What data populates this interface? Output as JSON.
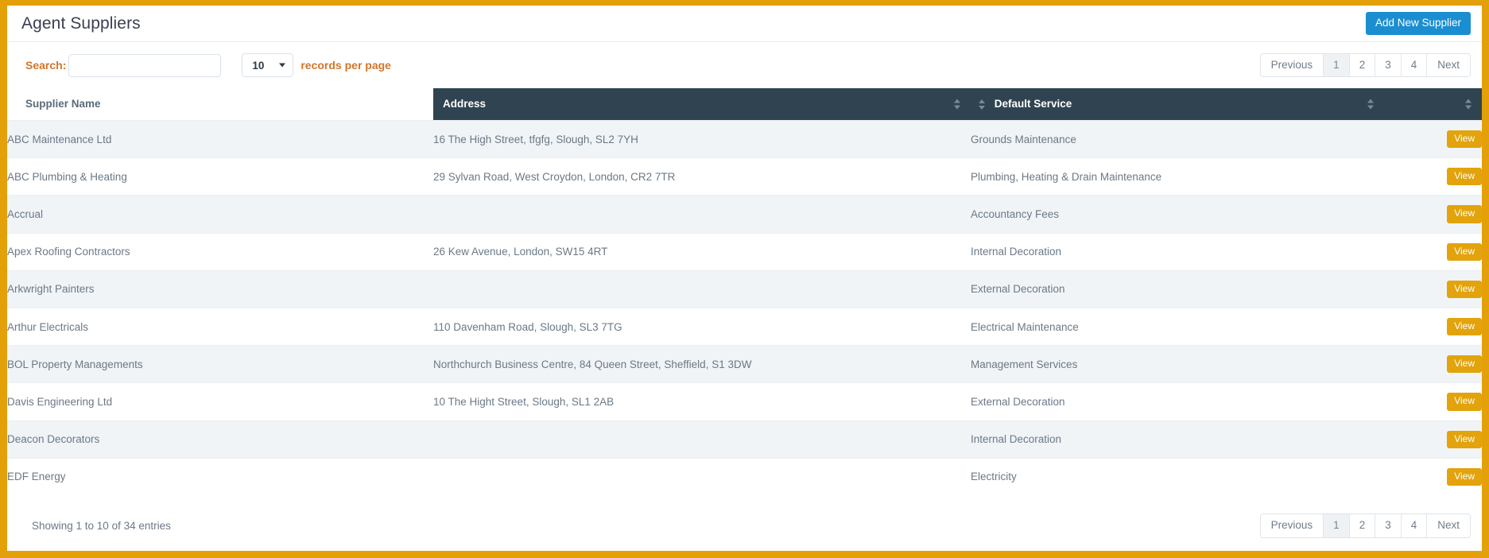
{
  "header": {
    "title": "Agent Suppliers",
    "add_button": "Add New Supplier",
    "accent_blue": "#1b8ed1",
    "frame_orange": "#e3a008"
  },
  "toolbar": {
    "search_label": "Search:",
    "search_value": "",
    "search_placeholder": "",
    "page_length_value": "10",
    "records_per_page_label": "records per page",
    "label_color": "#d2762a"
  },
  "pagination": {
    "previous": "Previous",
    "next": "Next",
    "pages": [
      "1",
      "2",
      "3",
      "4"
    ],
    "active_page": "1"
  },
  "table": {
    "header_bg": "#2f4450",
    "columns": [
      {
        "key": "name",
        "label": "Supplier Name",
        "sortable": false,
        "sort_left": false,
        "sort_right": false
      },
      {
        "key": "address",
        "label": "Address",
        "sortable": true,
        "sort_left": false,
        "sort_right": true
      },
      {
        "key": "service",
        "label": "Default Service",
        "sortable": true,
        "sort_left": true,
        "sort_right": true
      },
      {
        "key": "action",
        "label": "",
        "sortable": true,
        "sort_left": false,
        "sort_right": true
      }
    ],
    "action_label": "View",
    "action_color": "#e2a30c",
    "rows": [
      {
        "name": "ABC Maintenance Ltd",
        "address": "16 The High Street, tfgfg, Slough, SL2 7YH",
        "service": "Grounds Maintenance"
      },
      {
        "name": "ABC Plumbing & Heating",
        "address": "29 Sylvan Road, West Croydon, London, CR2 7TR",
        "service": "Plumbing, Heating & Drain Maintenance"
      },
      {
        "name": "Accrual",
        "address": "",
        "service": "Accountancy Fees"
      },
      {
        "name": "Apex Roofing Contractors",
        "address": "26 Kew Avenue, London, SW15 4RT",
        "service": "Internal Decoration"
      },
      {
        "name": "Arkwright Painters",
        "address": "",
        "service": "External Decoration"
      },
      {
        "name": "Arthur Electricals",
        "address": "110 Davenham Road, Slough, SL3 7TG",
        "service": "Electrical Maintenance"
      },
      {
        "name": "BOL Property Managements",
        "address": "Northchurch Business Centre, 84 Queen Street, Sheffield, S1 3DW",
        "service": "Management Services"
      },
      {
        "name": "Davis Engineering Ltd",
        "address": "10 The Hight Street, Slough, SL1 2AB",
        "service": "External Decoration"
      },
      {
        "name": "Deacon Decorators",
        "address": "",
        "service": "Internal Decoration"
      },
      {
        "name": "EDF Energy",
        "address": "",
        "service": "Electricity"
      }
    ]
  },
  "footer": {
    "entries_info": "Showing 1 to 10 of 34 entries"
  }
}
